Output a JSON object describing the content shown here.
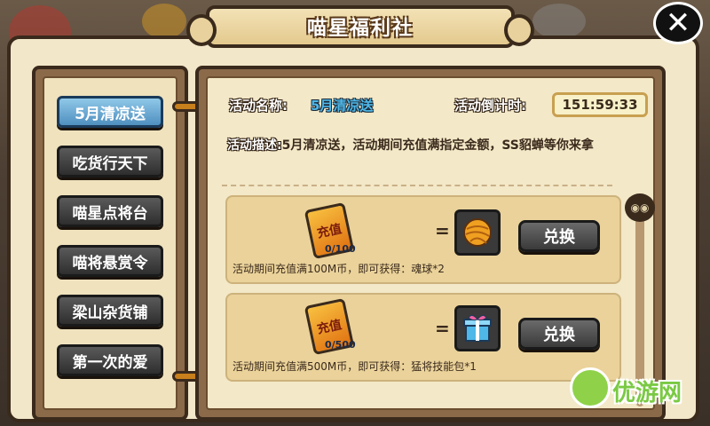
{
  "title": "喵星福利社",
  "close_icon": "close-icon",
  "menu": [
    {
      "label": "5月清凉送",
      "active": true
    },
    {
      "label": "吃货行天下",
      "active": false
    },
    {
      "label": "喵星点将台",
      "active": false
    },
    {
      "label": "喵将悬赏令",
      "active": false
    },
    {
      "label": "梁山杂货铺",
      "active": false
    },
    {
      "label": "第一次的爱",
      "active": false
    }
  ],
  "activity": {
    "name_label": "活动名称:",
    "name_value": "5月清凉送",
    "countdown_label": "活动倒计时:",
    "countdown_value": "151:59:33",
    "desc_label": "活动描述:",
    "desc_text": "5月清凉送，活动期间充值满指定金额，SS貂蝉等你来拿"
  },
  "rewards": [
    {
      "card_text": "充值",
      "progress": "0/100",
      "equals": "=",
      "item_icon": "yarn-ball-icon",
      "button": "兑换",
      "text": "活动期间充值满100M币，即可获得：魂球*2"
    },
    {
      "card_text": "充值",
      "progress": "0/500",
      "equals": "=",
      "item_icon": "gift-box-icon",
      "button": "兑换",
      "text": "活动期间充值满500M币，即可获得：猛将技能包*1"
    }
  ],
  "watermark": "优游网",
  "colors": {
    "accent_blue": "#4fb8e8",
    "frame_dark": "#3a2a1c",
    "parchment": "#f3e8c7"
  }
}
